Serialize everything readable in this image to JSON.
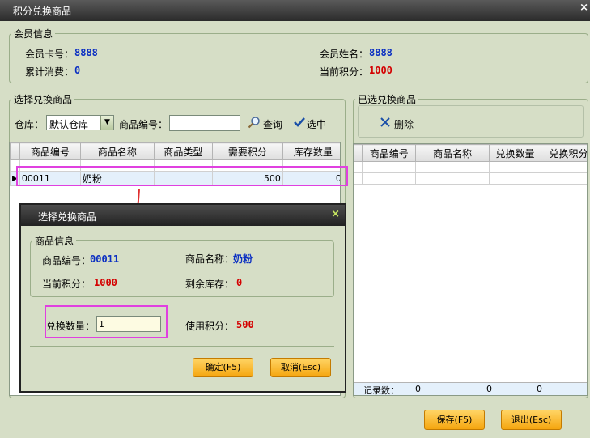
{
  "window": {
    "title": "积分兑换商品",
    "close": "×"
  },
  "member": {
    "legend": "会员信息",
    "card_label": "会员卡号：",
    "card_value": "8888",
    "name_label": "会员姓名：",
    "name_value": "8888",
    "spent_label": "累计消费：",
    "spent_value": "0",
    "points_label": "当前积分：",
    "points_value": "1000"
  },
  "select_panel": {
    "legend": "选择兑换商品",
    "warehouse_label": "仓库：",
    "warehouse_value": "默认仓库",
    "code_label": "商品编号：",
    "code_value": "",
    "query_label": "查询",
    "select_label": "选中",
    "columns": [
      "商品编号",
      "商品名称",
      "商品类型",
      "需要积分",
      "库存数量"
    ],
    "row": {
      "code": "00011",
      "name": "奶粉",
      "type": "",
      "points": "500",
      "stock": "0"
    }
  },
  "selected_panel": {
    "legend": "已选兑换商品",
    "delete_label": "删除",
    "columns": [
      "商品编号",
      "商品名称",
      "兑换数量",
      "兑换积分"
    ],
    "footer_label": "记录数：",
    "footer_values": [
      "0",
      "0",
      "0"
    ]
  },
  "dialog": {
    "title": "选择兑换商品",
    "close": "×",
    "legend": "商品信息",
    "code_label": "商品编号：",
    "code_value": "00011",
    "name_label": "商品名称：",
    "name_value": "奶粉",
    "points_label": "当前积分：",
    "points_value": "1000",
    "stock_label": "剩余库存：",
    "stock_value": "0",
    "qty_label": "兑换数量：",
    "qty_value": "1",
    "use_label": "使用积分：",
    "use_value": "500",
    "ok_label": "确定(F5)",
    "cancel_label": "取消(Esc)"
  },
  "buttons": {
    "save": "保存(F5)",
    "exit": "退出(Esc)"
  },
  "colors": {
    "highlight": "#e040e0",
    "arrow": "#e03030",
    "value_blue": "#0b2fc2",
    "value_red": "#d40000"
  }
}
